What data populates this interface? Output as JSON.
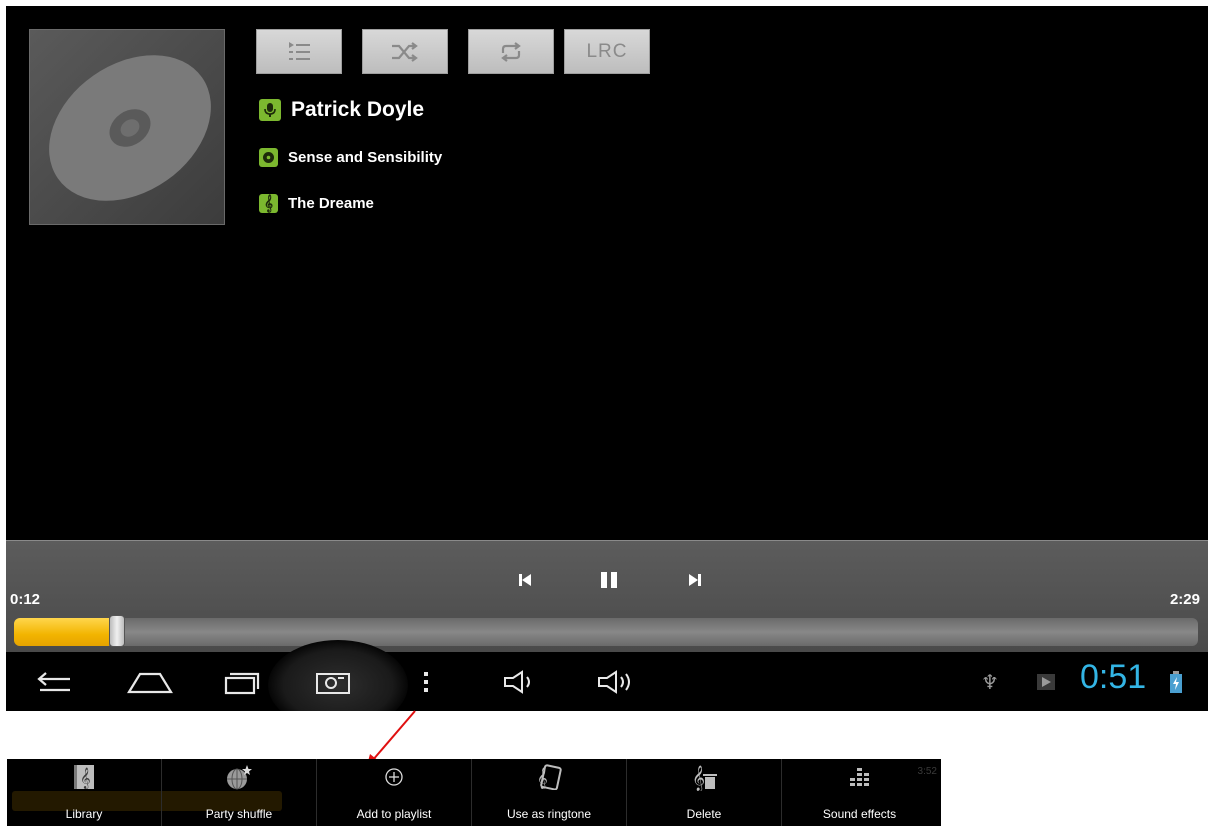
{
  "player": {
    "artist": "Patrick Doyle",
    "album": "Sense and Sensibility",
    "track": "The Dreame",
    "top_buttons": [
      {
        "icon": "playlist-icon"
      },
      {
        "icon": "shuffle-icon"
      },
      {
        "icon": "repeat-icon"
      },
      {
        "label": "LRC"
      }
    ],
    "elapsed": "0:12",
    "duration": "2:29",
    "progress_fraction": 0.08,
    "accent": "#f2b400"
  },
  "navbar": {
    "clock": "0:51",
    "clock_color": "#33b5e5"
  },
  "menu": {
    "items": [
      {
        "label": "Library",
        "icon": "library-icon"
      },
      {
        "label": "Party shuffle",
        "icon": "party-shuffle-icon"
      },
      {
        "label": "Add to playlist",
        "icon": "add-circle-icon"
      },
      {
        "label": "Use as ringtone",
        "icon": "ringtone-icon"
      },
      {
        "label": "Delete",
        "icon": "delete-icon"
      },
      {
        "label": "Sound effects",
        "icon": "equalizer-icon"
      }
    ],
    "ghost_time": "3:52"
  },
  "annotation": {
    "arrow_color": "#e01010"
  }
}
